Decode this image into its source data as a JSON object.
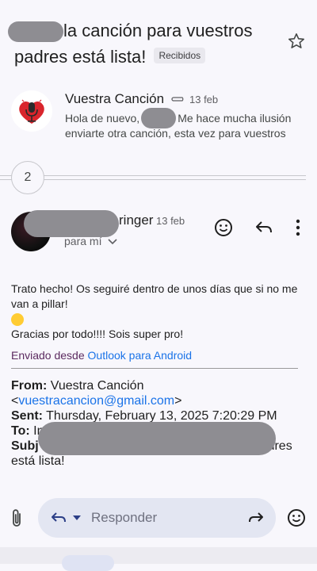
{
  "subject": {
    "text": "la canción para vuestros padres está lista!",
    "label_badge": "Recibidos"
  },
  "message1": {
    "sender": "Vuestra Canción",
    "date": "13 feb",
    "snippet_part1": "Hola de nuevo,",
    "snippet_part2": "Me hace mucha ilusión enviarte otra canción, esta vez para vuestros"
  },
  "collapsed": {
    "count": "2"
  },
  "message2": {
    "sender_visible": "ringer",
    "date": "13 feb",
    "to_me": "para mí",
    "body_line1": "Trato hecho! Os seguiré dentro de unos días que si no me van a pillar!",
    "body_line2": "Gracias por todo!!!! Sois super pro!",
    "sig_prefix": "Enviado desde ",
    "sig_link": "Outlook para Android",
    "fwd": {
      "from_label": "From:",
      "from_name": "Vuestra Canción",
      "from_email": "vuestracancion@gmail.com",
      "sent_label": "Sent:",
      "sent_value": "Thursday, February 13, 2025 7:20:29 PM",
      "to_label": "To:",
      "to_visible": "In",
      "subject_label": "Subj",
      "subject_tail": "adres",
      "subject_line2": "está lista!"
    }
  },
  "reply_bar": {
    "placeholder": "Responder"
  },
  "icons": [
    "star-icon",
    "attachment-icon",
    "emoji-icon",
    "reply-icon",
    "more-vert-icon",
    "forward-icon",
    "chevron-down-icon"
  ]
}
